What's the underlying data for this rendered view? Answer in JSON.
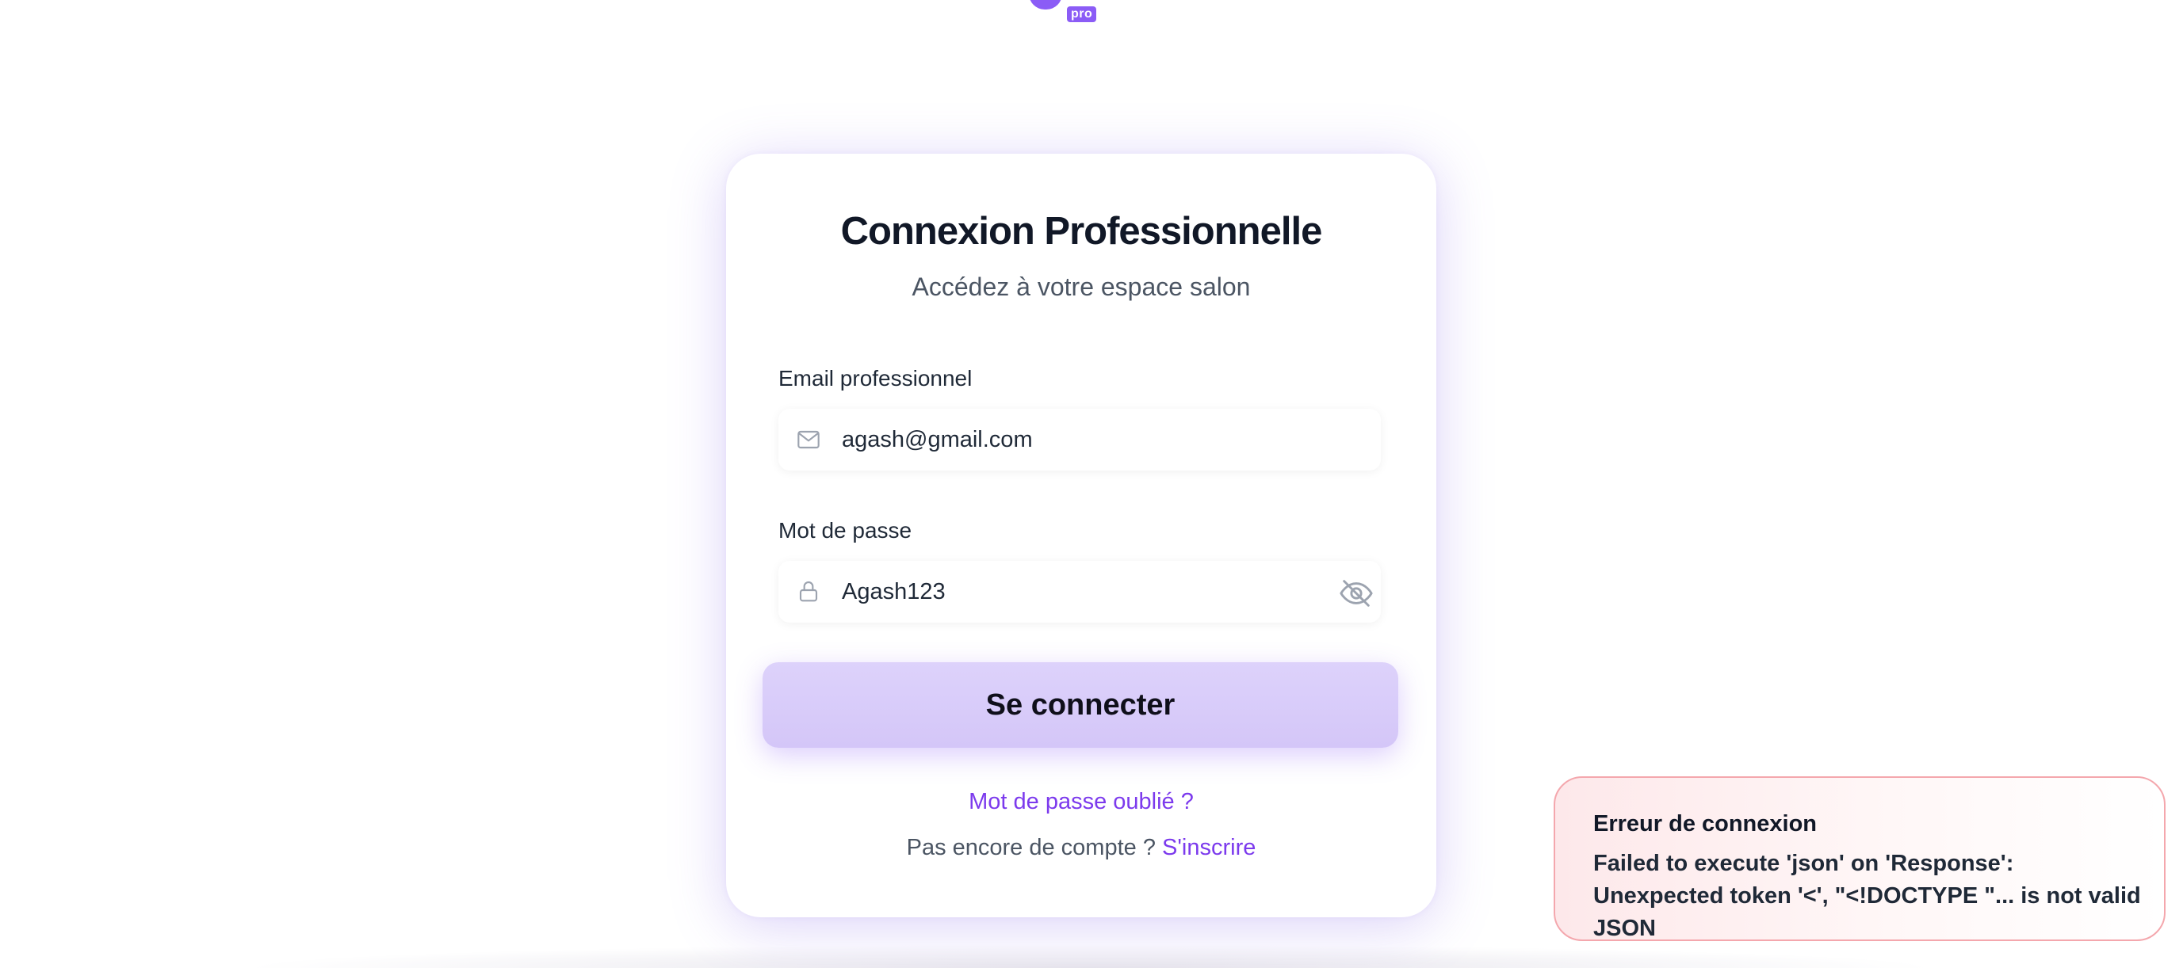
{
  "logo": {
    "badge": "pro"
  },
  "login": {
    "title": "Connexion Professionnelle",
    "subtitle": "Accédez à votre espace salon",
    "email": {
      "label": "Email professionnel",
      "value": "agash@gmail.com",
      "icon": "mail-icon"
    },
    "password": {
      "label": "Mot de passe",
      "value": "Agash123",
      "icon": "lock-icon",
      "toggle_icon": "eye-off-icon"
    },
    "submit_label": "Se connecter",
    "forgot_label": "Mot de passe oublié ?",
    "signup_prompt": "Pas encore de compte ?",
    "signup_label": "S'inscrire"
  },
  "toast": {
    "title": "Erreur de connexion",
    "message": "Failed to execute 'json' on 'Response': Unexpected token '<', \"<!DOCTYPE \"... is not valid JSON"
  },
  "colors": {
    "accent": "#7c3aed",
    "button_bg": "#d9ccfa",
    "error_border": "#f4a7ad",
    "error_bg": "#fde8ea"
  }
}
